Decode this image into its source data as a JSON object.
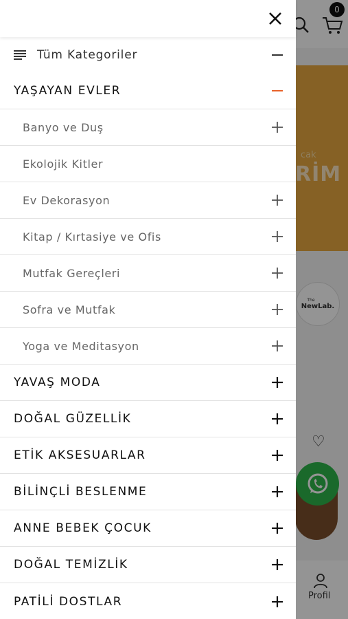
{
  "background": {
    "cart_count": "0",
    "banner_small": "cak",
    "banner_big": "RİM",
    "brand_small": "The",
    "brand_name": "NewLab.",
    "profile_label": "Profil"
  },
  "colors": {
    "accent": "#e8622a",
    "banner": "#e7a840",
    "whatsapp": "#2eb54a"
  },
  "drawer": {
    "all_categories": "Tüm Kategoriler",
    "categories": [
      {
        "label": "YAŞAYAN EVLER",
        "expanded": true
      },
      {
        "label": "YAVAŞ MODA",
        "expanded": false
      },
      {
        "label": "DOĞAL GÜZELLİK",
        "expanded": false
      },
      {
        "label": "ETİK AKSESUARLAR",
        "expanded": false
      },
      {
        "label": "BİLİNÇLİ BESLENME",
        "expanded": false
      },
      {
        "label": "ANNE BEBEK ÇOCUK",
        "expanded": false
      },
      {
        "label": "DOĞAL TEMİZLİK",
        "expanded": false
      },
      {
        "label": "PATİLİ DOSTLAR",
        "expanded": false
      }
    ],
    "subcategories": [
      {
        "label": "Banyo ve Duş",
        "has_children": true
      },
      {
        "label": "Ekolojik Kitler",
        "has_children": false
      },
      {
        "label": "Ev Dekorasyon",
        "has_children": true
      },
      {
        "label": "Kitap / Kırtasiye ve Ofis",
        "has_children": true
      },
      {
        "label": "Mutfak Gereçleri",
        "has_children": true
      },
      {
        "label": "Sofra ve Mutfak",
        "has_children": true
      },
      {
        "label": "Yoga ve Meditasyon",
        "has_children": true
      }
    ]
  }
}
